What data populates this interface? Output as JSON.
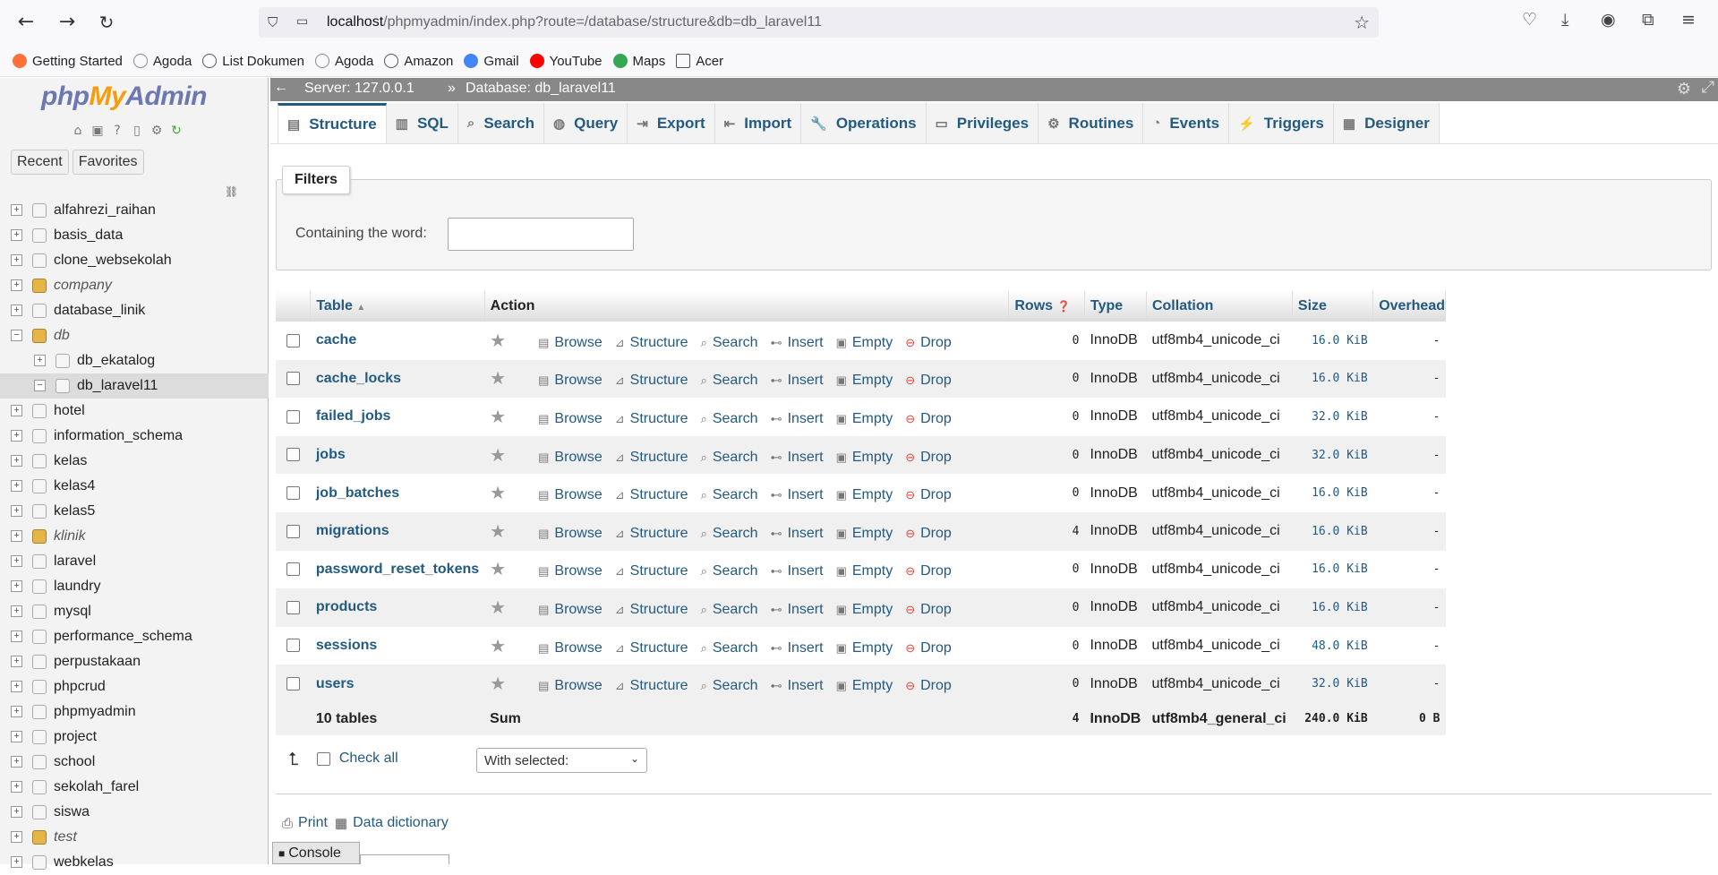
{
  "browser": {
    "url_host": "localhost",
    "url_path": "/phpmyadmin/index.php?route=/database/structure&db=db_laravel11",
    "bookmarks": [
      {
        "label": "Getting Started",
        "icon": "firefox-icon",
        "color": "#ff7139"
      },
      {
        "label": "Agoda",
        "icon": "agoda-icon",
        "color": "#888888"
      },
      {
        "label": "List Dokumen",
        "icon": "globe-icon",
        "color": "#555555"
      },
      {
        "label": "Agoda",
        "icon": "agoda-icon",
        "color": "#888888"
      },
      {
        "label": "Amazon",
        "icon": "globe-icon",
        "color": "#555555"
      },
      {
        "label": "Gmail",
        "icon": "google-icon",
        "color": "#4285f4"
      },
      {
        "label": "YouTube",
        "icon": "youtube-icon",
        "color": "#ff0000"
      },
      {
        "label": "Maps",
        "icon": "maps-icon",
        "color": "#34a853"
      },
      {
        "label": "Acer",
        "icon": "folder-icon",
        "color": "#555555"
      }
    ]
  },
  "sidebar": {
    "logo_php": "php",
    "logo_my": "My",
    "logo_admin": "Admin",
    "recent": "Recent",
    "favorites": "Favorites",
    "databases": [
      {
        "name": "alfahrezi_raihan",
        "group": false
      },
      {
        "name": "basis_data",
        "group": false
      },
      {
        "name": "clone_websekolah",
        "group": false
      },
      {
        "name": "company",
        "group": true
      },
      {
        "name": "database_linik",
        "group": false
      },
      {
        "name": "db",
        "group": true,
        "expanded": true
      },
      {
        "name": "db_ekatalog",
        "child": true
      },
      {
        "name": "db_laravel11",
        "child": true,
        "active": true
      },
      {
        "name": "hotel",
        "group": false
      },
      {
        "name": "information_schema",
        "group": false
      },
      {
        "name": "kelas",
        "group": false
      },
      {
        "name": "kelas4",
        "group": false
      },
      {
        "name": "kelas5",
        "group": false
      },
      {
        "name": "klinik",
        "group": true
      },
      {
        "name": "laravel",
        "group": false
      },
      {
        "name": "laundry",
        "group": false
      },
      {
        "name": "mysql",
        "group": false
      },
      {
        "name": "performance_schema",
        "group": false
      },
      {
        "name": "perpustakaan",
        "group": false
      },
      {
        "name": "phpcrud",
        "group": false
      },
      {
        "name": "phpmyadmin",
        "group": false
      },
      {
        "name": "project",
        "group": false
      },
      {
        "name": "school",
        "group": false
      },
      {
        "name": "sekolah_farel",
        "group": false
      },
      {
        "name": "siswa",
        "group": false
      },
      {
        "name": "test",
        "group": true
      },
      {
        "name": "webkelas",
        "group": false
      }
    ]
  },
  "topbar": {
    "server": "Server: 127.0.0.1",
    "sep": "»",
    "database": "Database: db_laravel11"
  },
  "tabs": [
    {
      "label": "Structure",
      "icon": "structure-icon",
      "active": true
    },
    {
      "label": "SQL",
      "icon": "sql-icon"
    },
    {
      "label": "Search",
      "icon": "search-icon"
    },
    {
      "label": "Query",
      "icon": "query-icon"
    },
    {
      "label": "Export",
      "icon": "export-icon"
    },
    {
      "label": "Import",
      "icon": "import-icon"
    },
    {
      "label": "Operations",
      "icon": "wrench-icon"
    },
    {
      "label": "Privileges",
      "icon": "privileges-icon"
    },
    {
      "label": "Routines",
      "icon": "routines-icon"
    },
    {
      "label": "Events",
      "icon": "clock-icon"
    },
    {
      "label": "Triggers",
      "icon": "triggers-icon"
    },
    {
      "label": "Designer",
      "icon": "designer-icon"
    }
  ],
  "filters": {
    "legend": "Filters",
    "label": "Containing the word:",
    "value": ""
  },
  "table": {
    "headers": {
      "table": "Table",
      "action": "Action",
      "rows": "Rows",
      "type": "Type",
      "collation": "Collation",
      "size": "Size",
      "overhead": "Overhead"
    },
    "actions": {
      "browse": "Browse",
      "structure": "Structure",
      "search": "Search",
      "insert": "Insert",
      "empty": "Empty",
      "drop": "Drop"
    },
    "rows": [
      {
        "name": "cache",
        "rows": "0",
        "type": "InnoDB",
        "collation": "utf8mb4_unicode_ci",
        "size": "16.0 KiB",
        "overhead": "-"
      },
      {
        "name": "cache_locks",
        "rows": "0",
        "type": "InnoDB",
        "collation": "utf8mb4_unicode_ci",
        "size": "16.0 KiB",
        "overhead": "-"
      },
      {
        "name": "failed_jobs",
        "rows": "0",
        "type": "InnoDB",
        "collation": "utf8mb4_unicode_ci",
        "size": "32.0 KiB",
        "overhead": "-"
      },
      {
        "name": "jobs",
        "rows": "0",
        "type": "InnoDB",
        "collation": "utf8mb4_unicode_ci",
        "size": "32.0 KiB",
        "overhead": "-"
      },
      {
        "name": "job_batches",
        "rows": "0",
        "type": "InnoDB",
        "collation": "utf8mb4_unicode_ci",
        "size": "16.0 KiB",
        "overhead": "-"
      },
      {
        "name": "migrations",
        "rows": "4",
        "type": "InnoDB",
        "collation": "utf8mb4_unicode_ci",
        "size": "16.0 KiB",
        "overhead": "-"
      },
      {
        "name": "password_reset_tokens",
        "rows": "0",
        "type": "InnoDB",
        "collation": "utf8mb4_unicode_ci",
        "size": "16.0 KiB",
        "overhead": "-"
      },
      {
        "name": "products",
        "rows": "0",
        "type": "InnoDB",
        "collation": "utf8mb4_unicode_ci",
        "size": "16.0 KiB",
        "overhead": "-"
      },
      {
        "name": "sessions",
        "rows": "0",
        "type": "InnoDB",
        "collation": "utf8mb4_unicode_ci",
        "size": "48.0 KiB",
        "overhead": "-"
      },
      {
        "name": "users",
        "rows": "0",
        "type": "InnoDB",
        "collation": "utf8mb4_unicode_ci",
        "size": "32.0 KiB",
        "overhead": "-"
      }
    ],
    "summary": {
      "tables": "10 tables",
      "sum": "Sum",
      "rows": "4",
      "type": "InnoDB",
      "collation": "utf8mb4_general_ci",
      "size": "240.0 KiB",
      "overhead": "0 B"
    }
  },
  "bottom": {
    "check_all": "Check all",
    "with_selected": "With selected:",
    "print": "Print",
    "data_dictionary": "Data dictionary",
    "console": "Console"
  }
}
